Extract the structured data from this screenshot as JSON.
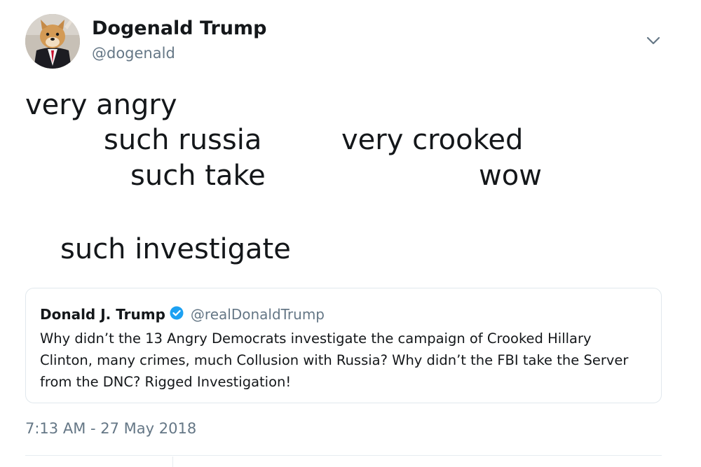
{
  "author": {
    "name": "Dogenald Trump",
    "handle": "@dogenald",
    "avatar_icon": "doge-in-suit-avatar"
  },
  "tweet_lines": [
    "very angry",
    "such russia",
    "very crooked",
    "such take",
    "wow",
    "such investigate"
  ],
  "quoted_tweet": {
    "name": "Donald J. Trump",
    "verified_icon": "verified-badge-icon",
    "handle": "@realDonaldTrump",
    "body_lines": [
      "Why didn’t the 13 Angry Democrats investigate the campaign of Crooked Hillary",
      "Clinton, many crimes, much Collusion with Russia? Why didn’t the FBI take the Server",
      "from the DNC?  Rigged Investigation!"
    ]
  },
  "timestamp": "7:13 AM - 27 May 2018",
  "colors": {
    "text": "#14171a",
    "secondary": "#657786",
    "verified": "#1da1f2",
    "border": "#e1e8ed"
  }
}
